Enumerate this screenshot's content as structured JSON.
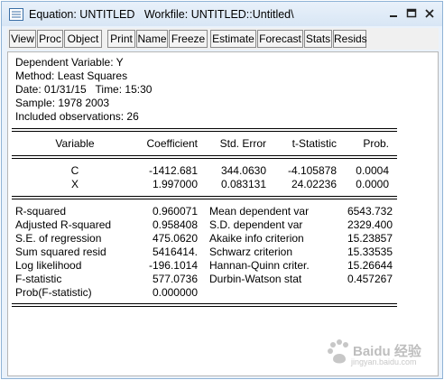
{
  "window": {
    "title": "Equation: UNTITLED   Workfile: UNTITLED::Untitled\\"
  },
  "toolbar": {
    "buttons": [
      "View",
      "Proc",
      "Object",
      "Print",
      "Name",
      "Freeze",
      "Estimate",
      "Forecast",
      "Stats",
      "Resids"
    ]
  },
  "header": {
    "lines": [
      "Dependent Variable: Y",
      "Method: Least Squares",
      "Date: 01/31/15   Time: 15:30",
      "Sample: 1978 2003",
      "Included observations: 26"
    ]
  },
  "coef_table": {
    "columns": [
      "Variable",
      "Coefficient",
      "Std. Error",
      "t-Statistic",
      "Prob."
    ],
    "rows": [
      [
        "C",
        "-1412.681",
        "344.0630",
        "-4.105878",
        "0.0004"
      ],
      [
        "X",
        "1.997000",
        "0.083131",
        "24.02236",
        "0.0000"
      ]
    ]
  },
  "stats": {
    "left": [
      {
        "label": "R-squared",
        "value": "0.960071"
      },
      {
        "label": "Adjusted R-squared",
        "value": "0.958408"
      },
      {
        "label": "S.E. of regression",
        "value": "475.0620"
      },
      {
        "label": "Sum squared resid",
        "value": "5416414."
      },
      {
        "label": "Log likelihood",
        "value": "-196.1014"
      },
      {
        "label": "F-statistic",
        "value": "577.0736"
      },
      {
        "label": "Prob(F-statistic)",
        "value": "0.000000"
      }
    ],
    "right": [
      {
        "label": "Mean dependent var",
        "value": "6543.732"
      },
      {
        "label": "S.D. dependent var",
        "value": "2329.400"
      },
      {
        "label": "Akaike info criterion",
        "value": "15.23857"
      },
      {
        "label": "Schwarz criterion",
        "value": "15.33535"
      },
      {
        "label": "Hannan-Quinn criter.",
        "value": "15.26644"
      },
      {
        "label": "Durbin-Watson stat",
        "value": "0.457267"
      }
    ]
  },
  "watermark": {
    "text": "Baidu 经验",
    "subtext": "jingyan.baidu.com"
  }
}
